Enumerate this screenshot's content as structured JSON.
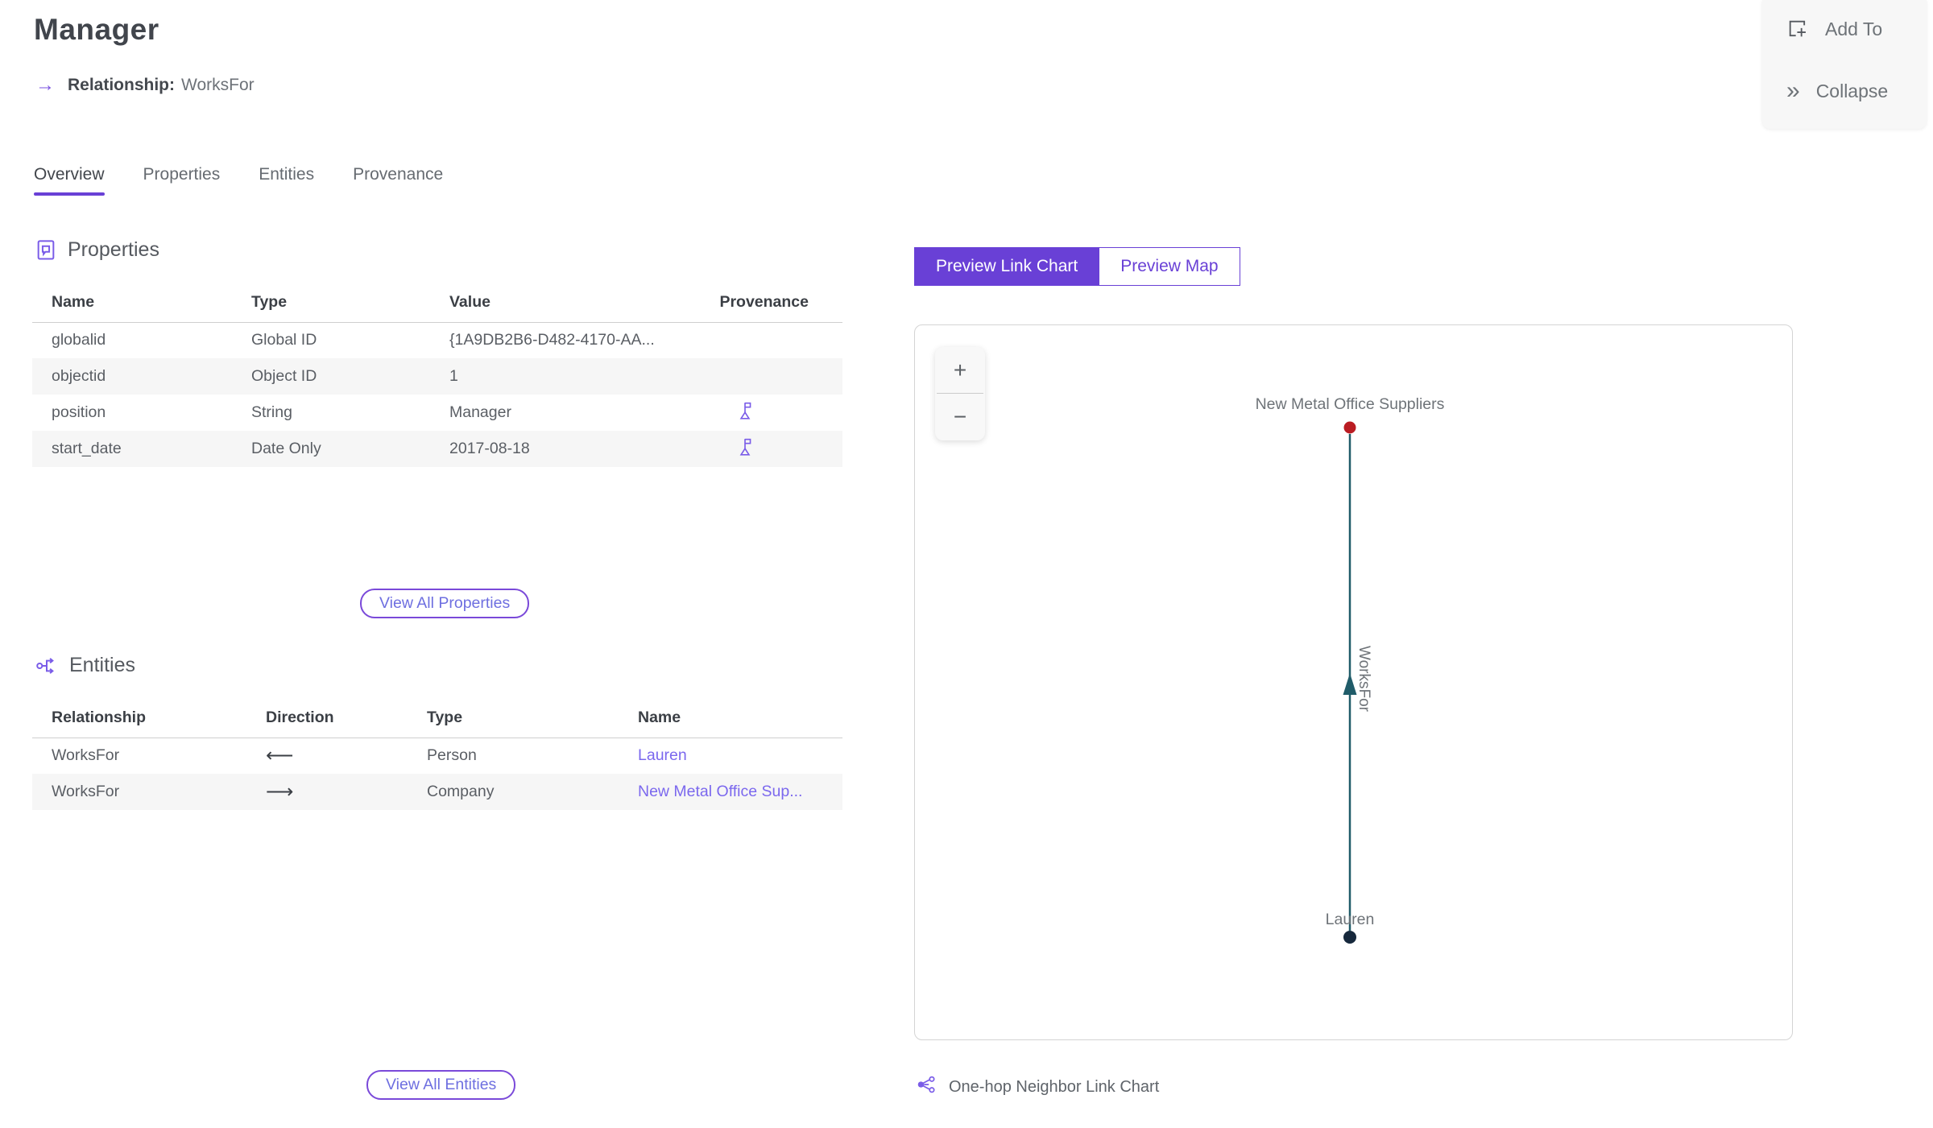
{
  "header": {
    "title": "Manager",
    "arrow_icon": "→",
    "relationship_label": "Relationship:",
    "relationship_value": "WorksFor"
  },
  "quick_actions": {
    "add_to": "Add To",
    "collapse": "Collapse",
    "collapse_icon": "»"
  },
  "tabs": [
    {
      "label": "Overview",
      "active": true
    },
    {
      "label": "Properties",
      "active": false
    },
    {
      "label": "Entities",
      "active": false
    },
    {
      "label": "Provenance",
      "active": false
    }
  ],
  "properties_section": {
    "heading": "Properties",
    "columns": {
      "name": "Name",
      "type": "Type",
      "value": "Value",
      "provenance": "Provenance"
    },
    "rows": [
      {
        "name": "globalid",
        "type": "Global ID",
        "value": "{1A9DB2B6-D482-4170-AA...",
        "provenance": false
      },
      {
        "name": "objectid",
        "type": "Object ID",
        "value": "1",
        "provenance": false
      },
      {
        "name": "position",
        "type": "String",
        "value": "Manager",
        "provenance": true
      },
      {
        "name": "start_date",
        "type": "Date Only",
        "value": "2017-08-18",
        "provenance": true
      }
    ],
    "view_all_label": "View All Properties"
  },
  "entities_section": {
    "heading": "Entities",
    "columns": {
      "relationship": "Relationship",
      "direction": "Direction",
      "type": "Type",
      "name": "Name"
    },
    "rows": [
      {
        "relationship": "WorksFor",
        "direction": "⟵",
        "type": "Person",
        "name": "Lauren"
      },
      {
        "relationship": "WorksFor",
        "direction": "⟶",
        "type": "Company",
        "name": "New Metal Office Sup..."
      }
    ],
    "view_all_label": "View All Entities"
  },
  "preview": {
    "tabs": [
      {
        "label": "Preview Link Chart",
        "active": true
      },
      {
        "label": "Preview Map",
        "active": false
      }
    ],
    "zoom_in": "+",
    "zoom_out": "−",
    "caption": "One-hop Neighbor Link Chart"
  },
  "link_chart": {
    "type": "node-link",
    "edge": {
      "label": "WorksFor",
      "color": "#205C69"
    },
    "nodes": [
      {
        "label": "New Metal Office Suppliers",
        "color": "#BA1C22"
      },
      {
        "label": "Lauren",
        "color": "#16283C"
      }
    ]
  },
  "colors": {
    "accent_purple": "#6940D6",
    "icon_purple": "#7A5CE8",
    "link_purple": "#7B68EE",
    "edge_teal": "#205C69",
    "node_red": "#BA1C22",
    "node_dark": "#16283C",
    "row_shade": "#F6F6F6"
  }
}
